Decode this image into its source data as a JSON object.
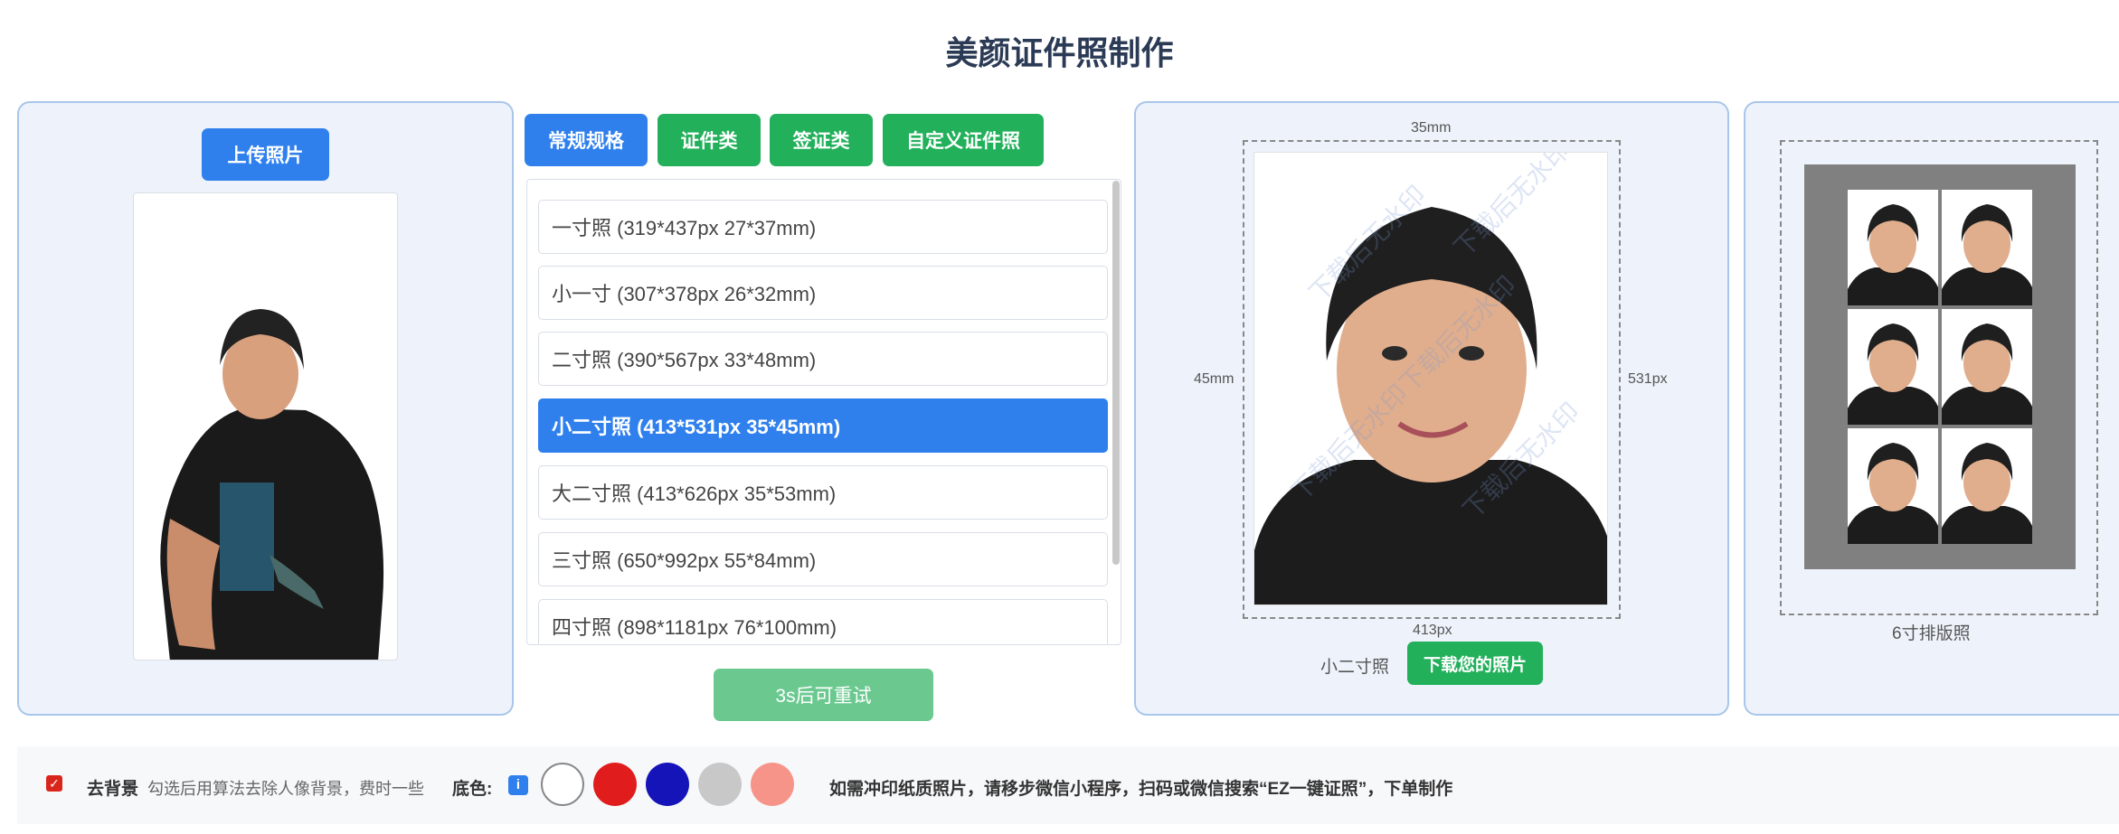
{
  "page": {
    "title": "美颜证件照制作"
  },
  "upload": {
    "button_label": "上传照片"
  },
  "tabs": [
    {
      "label": "常规规格",
      "active": true
    },
    {
      "label": "证件类",
      "active": false
    },
    {
      "label": "签证类",
      "active": false
    },
    {
      "label": "自定义证件照",
      "active": false
    }
  ],
  "specs": [
    {
      "label": "一寸照 (319*437px 27*37mm)",
      "selected": false
    },
    {
      "label": "小一寸 (307*378px 26*32mm)",
      "selected": false
    },
    {
      "label": "二寸照 (390*567px 33*48mm)",
      "selected": false
    },
    {
      "label": "小二寸照 (413*531px 35*45mm)",
      "selected": true
    },
    {
      "label": "大二寸照 (413*626px 35*53mm)",
      "selected": false
    },
    {
      "label": "三寸照 (650*992px 55*84mm)",
      "selected": false
    },
    {
      "label": "四寸照 (898*1181px 76*100mm)",
      "selected": false
    }
  ],
  "retry": {
    "label": "3s后可重试"
  },
  "preview": {
    "top_dim": "35mm",
    "left_dim": "45mm",
    "right_dim": "531px",
    "bottom_dim": "413px",
    "watermark": "下载后无水印",
    "size_name": "小二寸照",
    "download_label": "下载您的照片"
  },
  "layout_sheet": {
    "label": "6寸排版照",
    "count": 6
  },
  "bottom": {
    "remove_bg_checked": true,
    "remove_bg_label": "去背景",
    "remove_bg_hint": "勾选后用算法去除人像背景，费时一些",
    "bg_color_label": "底色:",
    "info_icon": "info-icon",
    "colors": [
      "#ffffff",
      "#e01c1c",
      "#1414b8",
      "#c8c8c8",
      "#f7948a"
    ],
    "print_notice": "如需冲印纸质照片，请移步微信小程序，扫码或微信搜索“EZ一键证照”，下单制作"
  }
}
